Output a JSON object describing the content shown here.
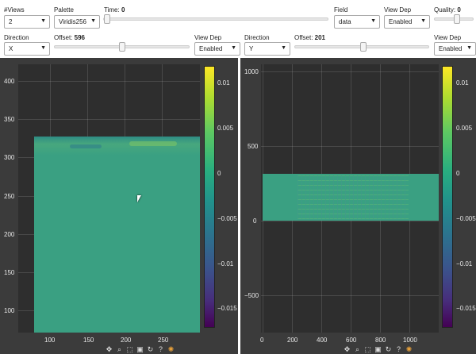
{
  "controls_top": {
    "views": {
      "label": "#Views",
      "value": "2"
    },
    "palette": {
      "label": "Palette",
      "value": "Viridis256"
    },
    "time": {
      "label": "Time:",
      "value": "0"
    },
    "field": {
      "label": "Field",
      "value": "data"
    },
    "view_dep": {
      "label": "View Dep",
      "value": "Enabled"
    },
    "quality": {
      "label": "Quality:",
      "value": "0"
    }
  },
  "left_view": {
    "direction": {
      "label": "Direction",
      "value": "X"
    },
    "offset": {
      "label": "Offset:",
      "value": "596"
    },
    "view_dep": {
      "label": "View Dep",
      "value": "Enabled"
    },
    "yticks": [
      "400",
      "350",
      "300",
      "250",
      "200",
      "150",
      "100"
    ],
    "xticks": [
      "100",
      "150",
      "200",
      "250"
    ],
    "cbar_ticks": [
      "0.01",
      "0.005",
      "0",
      "−0.005",
      "−0.01",
      "−0.015"
    ]
  },
  "right_view": {
    "direction": {
      "label": "Direction",
      "value": "Y"
    },
    "offset": {
      "label": "Offset:",
      "value": "201"
    },
    "view_dep": {
      "label": "View Dep",
      "value": "Enabled"
    },
    "yticks": [
      "1000",
      "500",
      "0",
      "−500"
    ],
    "xticks": [
      "0",
      "200",
      "400",
      "600",
      "800",
      "1000"
    ],
    "cbar_ticks": [
      "0.01",
      "0.005",
      "0",
      "−0.005",
      "−0.01",
      "−0.015"
    ]
  },
  "colors": {
    "panel_bg": "#3b3b3b",
    "plot_bg": "#2e2e2e",
    "field_fill": "#3aa082"
  }
}
